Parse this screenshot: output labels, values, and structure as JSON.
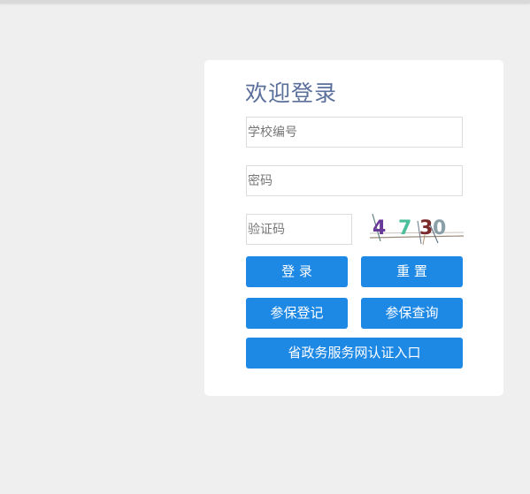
{
  "login": {
    "title": "欢迎登录",
    "school_placeholder": "学校编号",
    "password_placeholder": "密码",
    "captcha_placeholder": "验证码",
    "captcha_text": "4730",
    "buttons": {
      "login": "登 录",
      "reset": "重 置",
      "register": "参保登记",
      "query": "参保查询",
      "gov_auth": "省政务服务网认证入口"
    }
  },
  "colors": {
    "background": "#efefef",
    "card": "#ffffff",
    "title": "#5a6f9a",
    "button": "#1e88e5",
    "button_text": "#ffffff"
  }
}
